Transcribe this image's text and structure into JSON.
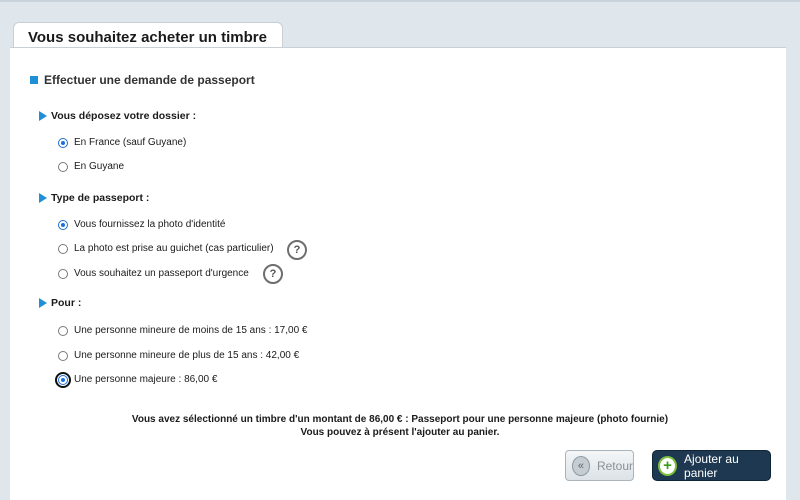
{
  "header": {
    "title": "Vous souhaitez acheter un timbre"
  },
  "section": {
    "title": "Effectuer une demande de passeport"
  },
  "groups": [
    {
      "label": "Vous déposez votre dossier :",
      "options": [
        {
          "label": "En France (sauf Guyane)",
          "selected": true
        },
        {
          "label": "En Guyane",
          "selected": false
        }
      ]
    },
    {
      "label": "Type de passeport :",
      "options": [
        {
          "label": "Vous fournissez la photo d'identité",
          "selected": true
        },
        {
          "label": "La photo est prise au guichet (cas particulier)",
          "selected": false,
          "help": "?"
        },
        {
          "label": "Vous souhaitez un passeport d'urgence",
          "selected": false,
          "help": "?"
        }
      ]
    },
    {
      "label": "Pour :",
      "options": [
        {
          "label": "Une personne mineure de moins de 15 ans : 17,00 €",
          "selected": false
        },
        {
          "label": "Une personne mineure de plus de 15 ans : 42,00 €",
          "selected": false
        },
        {
          "label": "Une personne majeure : 86,00 €",
          "selected": true
        }
      ]
    }
  ],
  "summary": {
    "line1": "Vous avez sélectionné un timbre d'un montant de 86,00 € : Passeport pour une personne majeure (photo fournie)",
    "line2": "Vous pouvez à présent l'ajouter au panier."
  },
  "buttons": {
    "back_label": "Retour",
    "back_icon_glyph": "«",
    "add_label": "Ajouter au panier",
    "add_icon_glyph": "+"
  },
  "colors": {
    "accent": "#1f8fd8",
    "primary_button": "#1d3850",
    "plus_icon": "#7bbf3b"
  }
}
